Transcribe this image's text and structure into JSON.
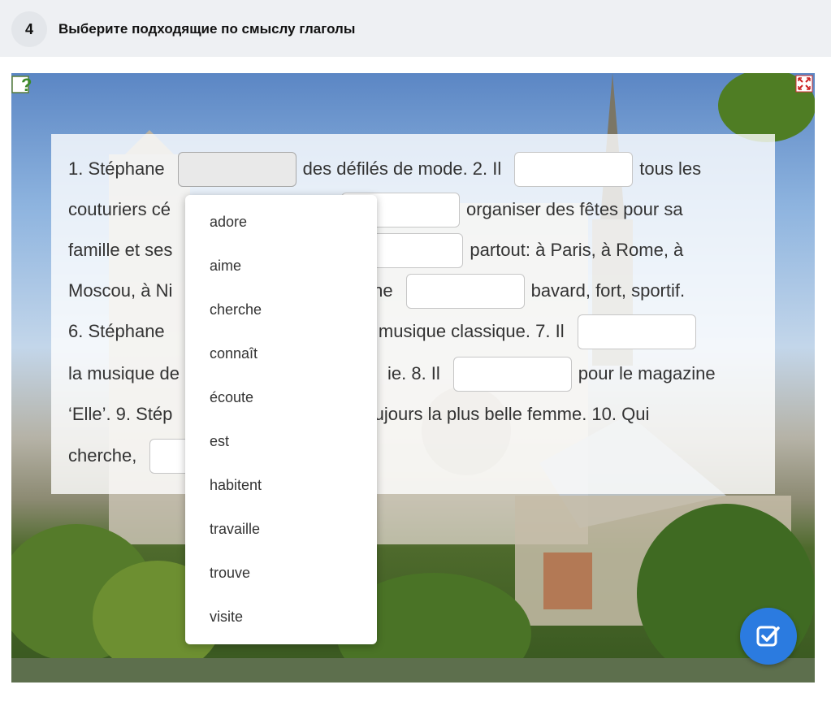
{
  "header": {
    "number": "4",
    "title": "Выберите подходящие по смыслу глаголы"
  },
  "exercise": {
    "lines": [
      [
        "1. Stéphane",
        "des défilés de mode. 2. Il",
        "tous les"
      ],
      [
        "couturiers cé",
        "organiser des fêtes pour sa"
      ],
      [
        "famille et ses",
        "partout: à Paris, à Rome, à"
      ],
      [
        "Moscou, à Ni",
        "phane",
        "bavard, fort, sportif."
      ],
      [
        "6. Stéphane",
        "la musique classique. 7. Il"
      ],
      [
        "la musique de",
        "ie. 8. Il",
        "pour le magazine"
      ],
      [
        "‘Elle’. 9. Stép",
        "oujours la plus belle femme. 10. Qui"
      ],
      [
        "cherche,"
      ]
    ]
  },
  "dropdown": {
    "options": [
      "adore",
      "aime",
      "cherche",
      "connaît",
      "écoute",
      "est",
      "habitent",
      "travaille",
      "trouve",
      "visite"
    ]
  },
  "colors": {
    "accent": "#2b7be0",
    "header_bg": "#eef0f3"
  },
  "icons": {
    "help": "help-question-icon",
    "fullscreen": "fullscreen-icon",
    "check": "check-icon"
  }
}
